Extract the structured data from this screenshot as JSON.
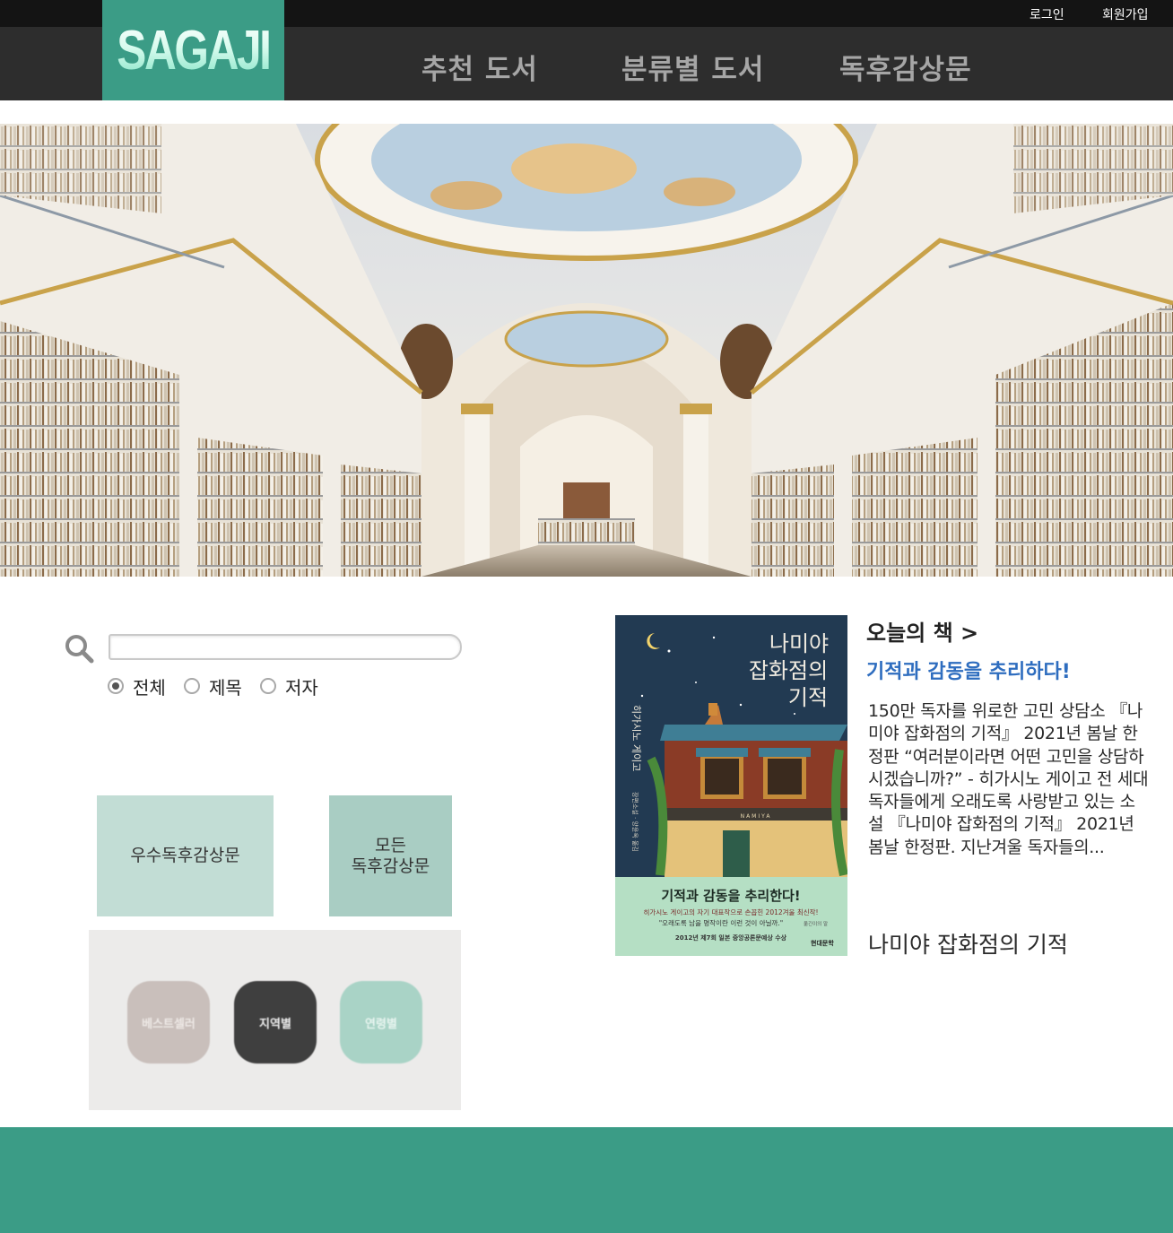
{
  "header": {
    "logo": "SAGAJI",
    "top_links": {
      "login": "로그인",
      "signup": "회원가입"
    },
    "nav": [
      "추천 도서",
      "분류별 도서",
      "독후감상문"
    ]
  },
  "search": {
    "placeholder": "",
    "options": [
      "전체",
      "제목",
      "저자"
    ],
    "selected": "전체"
  },
  "tiles": {
    "best_reviews": "우수독후감상문",
    "all_reviews": "모든\n독후감상문"
  },
  "categories": [
    "베스트셀러",
    "지역별",
    "연령별"
  ],
  "today": {
    "title": "오늘의 책 >",
    "tagline": "기적과 감동을 추리하다!",
    "description": "150만 독자를 위로한 고민 상담소 『나미야 잡화점의 기적』 2021년 봄날 한정판 “여러분이라면 어떤 고민을 상담하시겠습니까?” - 히가시노 게이고 전 세대 독자들에게 오래도록 사랑받고 있는 소설 『나미야 잡화점의 기적』 2021년 봄날 한정판. 지난겨울 독자들의...",
    "book_name": "나미야 잡화점의 기적",
    "cover": {
      "title_lines": [
        "나미야",
        "잡화점의",
        "기적"
      ],
      "author": "히가시노 게이고",
      "sub_author": "장편소설 · 양윤옥 옮김",
      "store_sign": "NAMIYA",
      "band_headline": "기적과 감동을 추리한다!",
      "band_line1": "히가시노 게이고의 자기 대표작으로 손꼽힌 2012겨울 최신작!",
      "band_line2": "\"오래도록 남을 명작이란 이런 것이 아닐까.\"",
      "band_line2_credit": "옮긴이의 말",
      "band_line3": "2012년 제7회 일본 중앙공론문예상 수상",
      "publisher": "현대문학"
    }
  },
  "colors": {
    "brand": "#3b9c86",
    "topbar": "#141414",
    "navbar": "#2d2d2d",
    "link_blue": "#2e6dbf"
  }
}
